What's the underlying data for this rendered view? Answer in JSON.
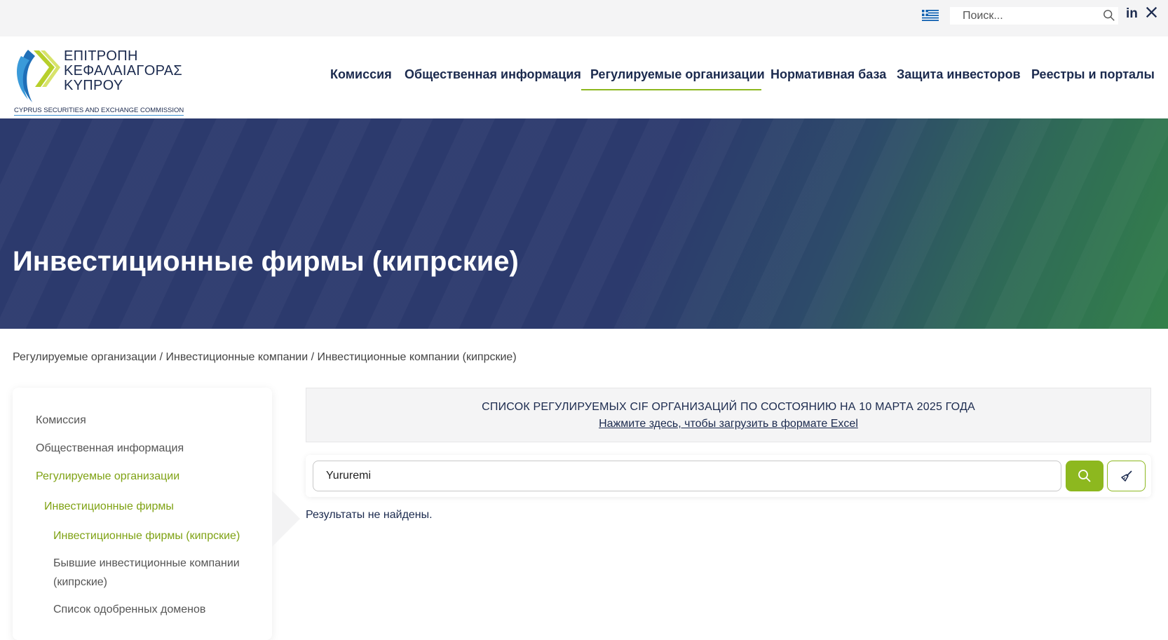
{
  "topbar": {
    "search_placeholder": "Поиск...",
    "social": {
      "linkedin": "in"
    }
  },
  "header": {
    "logo": {
      "line1": "ΕΠΙΤΡΟΠΗ",
      "line2": "ΚΕΦΑΛΑΙΑΓΟΡΑΣ",
      "line3": "ΚΥΠΡΟΥ",
      "subtitle": "CYPRUS SECURITIES AND EXCHANGE COMMISSION"
    },
    "nav": [
      {
        "label": "Комиссия"
      },
      {
        "label": "Общественная информация"
      },
      {
        "label": "Регулируемые организации",
        "active": true
      },
      {
        "label": "Нормативная база"
      },
      {
        "label": "Защита инвесторов"
      },
      {
        "label": "Реестры и порталы"
      }
    ]
  },
  "hero": {
    "title": "Инвестиционные фирмы (кипрские)"
  },
  "breadcrumb": [
    "Регулируемые организации",
    "Инвестиционные компании",
    "Инвестиционные компании (кипрские)"
  ],
  "breadcrumb_sep": " / ",
  "sidebar": {
    "items": [
      {
        "label": "Комиссия",
        "level": 0,
        "active": false
      },
      {
        "label": "Общественная информация",
        "level": 0,
        "active": false
      },
      {
        "label": "Регулируемые организации",
        "level": 0,
        "active": true
      },
      {
        "label": "Инвестиционные фирмы",
        "level": 1,
        "active": true
      },
      {
        "label": "Инвестиционные фирмы (кипрские)",
        "level": 2,
        "active": true
      },
      {
        "label": "Бывшие инвестиционные компании (кипрские)",
        "level": 2,
        "active": false
      },
      {
        "label": "Список одобренных доменов",
        "level": 2,
        "active": false
      }
    ]
  },
  "notice": {
    "title": "СПИСОК РЕГУЛИРУЕМЫХ CIF ОРГАНИЗАЦИЙ ПО СОСТОЯНИЮ НА 10 МАРТА 2025 ГОДА",
    "link": "Нажмите здесь, чтобы загрузить в формате Excel"
  },
  "search": {
    "value": "Yururemi"
  },
  "results": {
    "empty_message": "Результаты не найдены."
  },
  "colors": {
    "navy": "#1b2a4e",
    "accent_green": "#8db81f",
    "hero_blue": "#2c3a6d",
    "hero_green": "#33804a"
  }
}
